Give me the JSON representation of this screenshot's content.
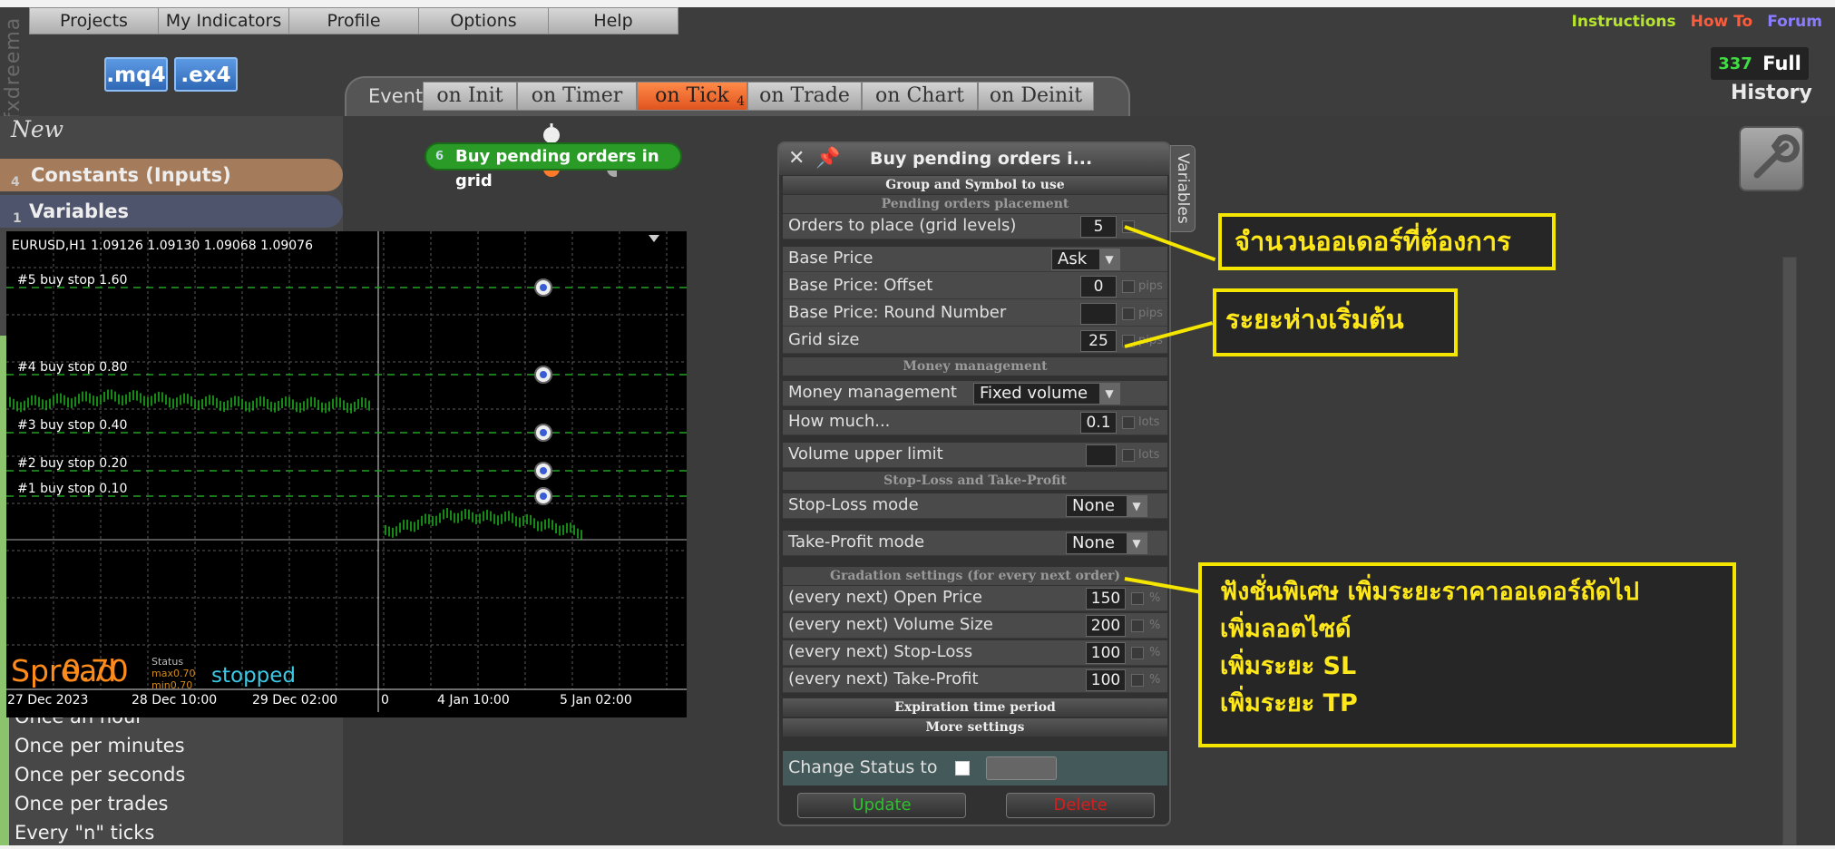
{
  "menu": {
    "items": [
      "Projects",
      "My Indicators",
      "Profile",
      "Options",
      "Help"
    ]
  },
  "brand": "fxdreema",
  "file_buttons": {
    "mq4": ".mq4",
    "ex4": ".ex4"
  },
  "top_links": {
    "instructions": "Instructions",
    "howto": "How To",
    "forum": "Forum"
  },
  "counter": {
    "value": "337",
    "full": "Full"
  },
  "history": "History",
  "tabs": {
    "label": "Events",
    "items": [
      "on Init",
      "on Timer",
      "on Tick",
      "on Trade",
      "on Chart",
      "on Deinit"
    ],
    "active_sub": "4"
  },
  "left": {
    "new": "New",
    "constants": {
      "num": "4",
      "label": "Constants (Inputs)"
    },
    "variables": {
      "num": "1",
      "label": "Variables"
    },
    "list": [
      "Once an hour",
      "Once per minutes",
      "Once per seconds",
      "Once per trades",
      "Every \"n\" ticks"
    ]
  },
  "node": {
    "num": "6",
    "label": "Buy pending orders in grid"
  },
  "chart": {
    "header": "EURUSD,H1  1.09126 1.09130 1.09068 1.09076",
    "levels": [
      "#5 buy stop 1.60",
      "#4 buy stop 0.80",
      "#3 buy stop 0.40",
      "#2 buy stop 0.20",
      "#1 buy stop 0.10"
    ],
    "xlabels": [
      "27 Dec 2023",
      "28 Dec 10:00",
      "29 Dec 02:00",
      "0",
      "4 Jan 10:00",
      "5 Jan 02:00"
    ],
    "spread_label": "Spread",
    "spread_value": "0.70",
    "max_label": "max0.70",
    "min_label": "min0.70",
    "status_label": "Status",
    "status": "stopped"
  },
  "panel": {
    "title": "Buy pending orders i...",
    "variables_tab": "Variables",
    "sections": {
      "group": "Group and Symbol to use",
      "placement": "Pending orders placement",
      "money": "Money management",
      "sltp": "Stop-Loss and Take-Profit",
      "gradation": "Gradation settings (for every next order)",
      "expiration": "Expiration time period",
      "more": "More settings"
    },
    "rows": {
      "orders": {
        "label": "Orders to place (grid levels)",
        "value": "5"
      },
      "base_price": {
        "label": "Base Price",
        "value": "Ask"
      },
      "offset": {
        "label": "Base Price: Offset",
        "value": "0",
        "unit": "pips"
      },
      "round": {
        "label": "Base Price: Round Number",
        "value": "",
        "unit": "pips"
      },
      "grid": {
        "label": "Grid size",
        "value": "25",
        "unit": "pips"
      },
      "mm": {
        "label": "Money management",
        "value": "Fixed volume"
      },
      "how_much": {
        "label": "How much...",
        "value": "0.1",
        "unit": "lots"
      },
      "vol_limit": {
        "label": "Volume upper limit",
        "value": "",
        "unit": "lots"
      },
      "sl_mode": {
        "label": "Stop-Loss mode",
        "value": "None"
      },
      "tp_mode": {
        "label": "Take-Profit mode",
        "value": "None"
      },
      "open_price": {
        "label": "(every next) Open Price",
        "value": "150",
        "unit": "%"
      },
      "volume_size": {
        "label": "(every next) Volume Size",
        "value": "200",
        "unit": "%"
      },
      "stop_loss": {
        "label": "(every next) Stop-Loss",
        "value": "100",
        "unit": "%"
      },
      "take_profit": {
        "label": "(every next) Take-Profit",
        "value": "100",
        "unit": "%"
      }
    },
    "change_status": "Change Status to",
    "update": "Update",
    "delete": "Delete"
  },
  "annotations": {
    "orders_count": "จำนวนออเดอร์ที่ต้องการ",
    "start_distance": "ระยะห่างเริ่มต้น",
    "special": [
      "ฟังชั่นพิเศษ เพิ่มระยะราคาออเดอร์ถัดไป",
      "เพิ่มลอตไซด์",
      "เพิ่มระยะ SL",
      "เพิ่มระยะ TP"
    ]
  },
  "colors": {
    "accent_orange": "#e0541f",
    "node_green": "#2b9b28",
    "annotation_yellow": "#f5e600",
    "chart_green": "#22d122"
  }
}
